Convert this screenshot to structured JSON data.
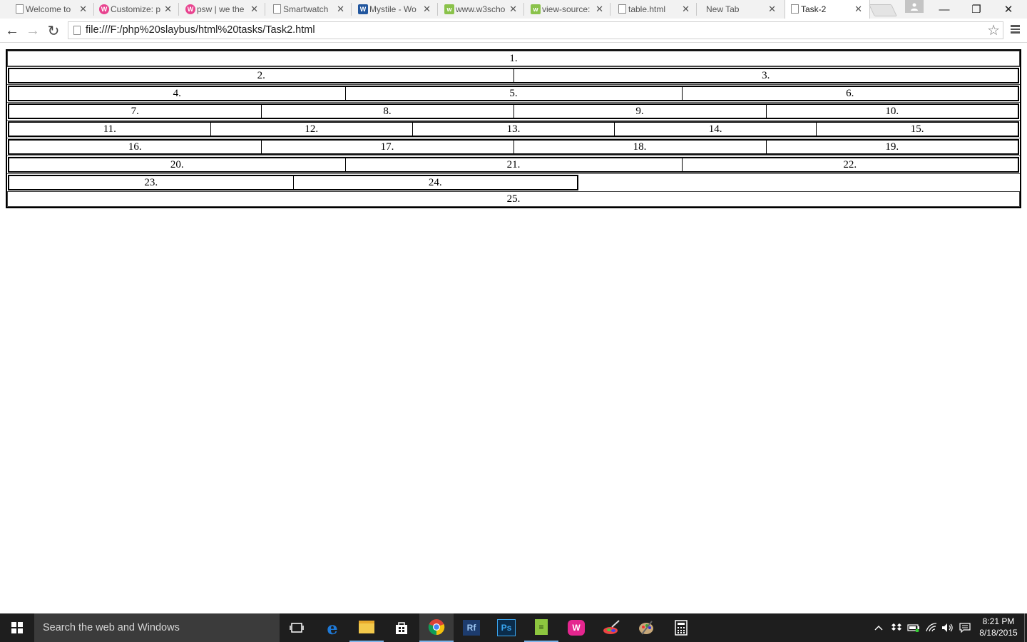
{
  "browser": {
    "tabs": [
      {
        "title": "Welcome to",
        "icon": "page-icon"
      },
      {
        "title": "Customize: p",
        "icon": "wordpress-icon"
      },
      {
        "title": "psw | we the",
        "icon": "wordpress-icon"
      },
      {
        "title": "Smartwatch",
        "icon": "page-icon"
      },
      {
        "title": "Mystile - Wo",
        "icon": "word-icon"
      },
      {
        "title": "www.w3scho",
        "icon": "w3schools-icon"
      },
      {
        "title": "view-source:",
        "icon": "w3schools-icon"
      },
      {
        "title": "table.html",
        "icon": "page-icon"
      },
      {
        "title": "New Tab",
        "icon": ""
      },
      {
        "title": "Task-2",
        "icon": "page-icon",
        "active": true
      }
    ],
    "close_glyph": "✕",
    "url": "file:///F:/php%20slaybus/html%20tasks/Task2.html",
    "window_controls": {
      "minimize": "—",
      "restore": "❐",
      "close": "✕"
    },
    "nav": {
      "back": "←",
      "forward": "→",
      "reload": "↻",
      "star": "☆"
    }
  },
  "page": {
    "row1": "1.",
    "row2": [
      "2.",
      "3."
    ],
    "row3": [
      "4.",
      "5.",
      "6."
    ],
    "row4": [
      "7.",
      "8.",
      "9.",
      "10."
    ],
    "row5": [
      "11.",
      "12.",
      "13.",
      "14.",
      "15."
    ],
    "row6": [
      "16.",
      "17.",
      "18.",
      "19."
    ],
    "row7": [
      "20.",
      "21.",
      "22."
    ],
    "row8": [
      "23.",
      "24."
    ],
    "row9": "25."
  },
  "taskbar": {
    "search_placeholder": "Search the web and Windows",
    "time": "8:21 PM",
    "date": "8/18/2015",
    "pinned": [
      "task-view-icon",
      "edge-icon",
      "file-explorer-icon",
      "store-icon",
      "chrome-icon",
      "reflector-icon",
      "photoshop-icon",
      "notepad-plus-icon",
      "wamp-icon",
      "paint-icon",
      "palette-icon",
      "calculator-icon"
    ]
  },
  "colors": {
    "taskbar_bg": "#1e1e1e",
    "accent": "#7eb4ea",
    "table_border": "#000000"
  }
}
